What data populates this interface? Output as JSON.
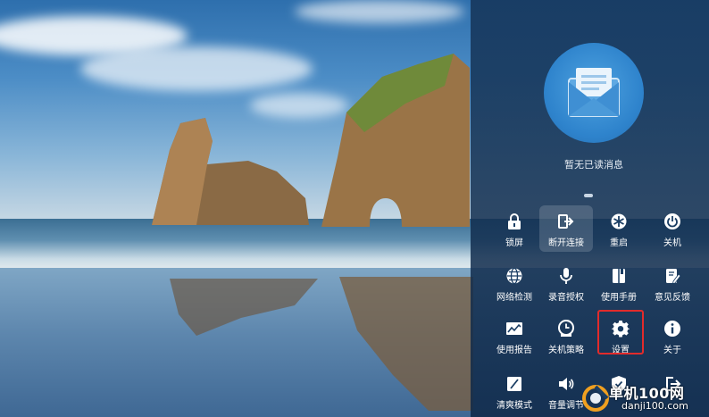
{
  "notification_center": {
    "empty_message": "暂无已读消息",
    "empty_icon": "envelope-icon",
    "accent": "#2e83cc",
    "highlight_color": "#e22b2b"
  },
  "quick_actions": [
    {
      "label": "锁屏",
      "icon": "lock-icon"
    },
    {
      "label": "断开连接",
      "icon": "disconnect-icon"
    },
    {
      "label": "重启",
      "icon": "restart-icon"
    },
    {
      "label": "关机",
      "icon": "power-icon"
    },
    {
      "label": "网络检测",
      "icon": "globe-icon"
    },
    {
      "label": "录音授权",
      "icon": "microphone-icon"
    },
    {
      "label": "使用手册",
      "icon": "manual-icon"
    },
    {
      "label": "意见反馈",
      "icon": "feedback-icon"
    },
    {
      "label": "使用报告",
      "icon": "report-chart-icon"
    },
    {
      "label": "关机策略",
      "icon": "shutdown-policy-icon"
    },
    {
      "label": "设置",
      "icon": "gear-icon"
    },
    {
      "label": "关于",
      "icon": "info-icon"
    },
    {
      "label": "清爽模式",
      "icon": "clean-mode-icon"
    },
    {
      "label": "音量调节",
      "icon": "volume-icon"
    },
    {
      "label": "",
      "icon": "shield-icon"
    },
    {
      "label": "",
      "icon": "exit-icon"
    }
  ],
  "watermark": {
    "title": "单机100网",
    "url": "danji100.com"
  }
}
